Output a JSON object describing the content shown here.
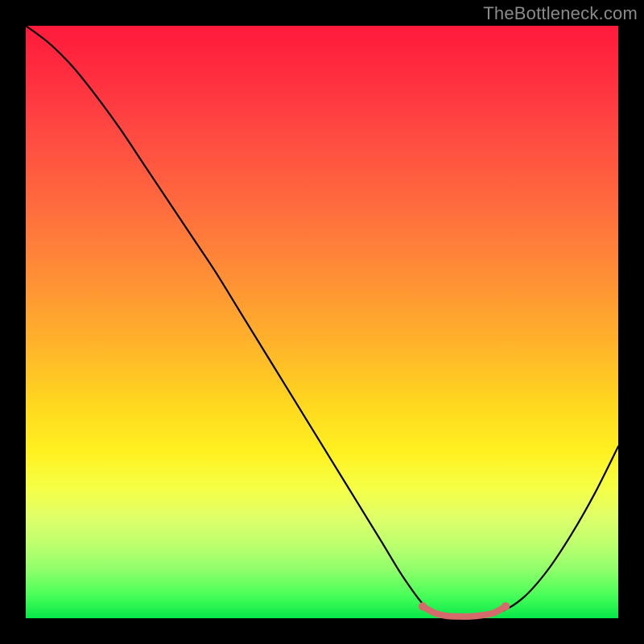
{
  "watermark": "TheBottleneck.com",
  "chart_data": {
    "type": "line",
    "title": "",
    "xlabel": "",
    "ylabel": "",
    "xlim": [
      0,
      100
    ],
    "ylim": [
      0,
      100
    ],
    "grid": false,
    "series": [
      {
        "name": "bottleneck-curve",
        "color": "#000000",
        "x": [
          0,
          4,
          8,
          12,
          16,
          20,
          24,
          28,
          32,
          36,
          40,
          44,
          48,
          52,
          56,
          60,
          64,
          68,
          72,
          76,
          80,
          84,
          88,
          92,
          96,
          100
        ],
        "y": [
          100,
          97,
          93,
          88,
          82.5,
          76.5,
          70.5,
          64.5,
          58.5,
          52.0,
          45.5,
          39.0,
          32.5,
          26.0,
          19.5,
          13.0,
          6.5,
          1.5,
          0.3,
          0.3,
          1.0,
          3.5,
          8.0,
          14.0,
          21.0,
          29.0
        ]
      },
      {
        "name": "optimal-range-marker",
        "color": "#d46a6a",
        "x": [
          67,
          69,
          71,
          73,
          75,
          77,
          79,
          81
        ],
        "y": [
          2.0,
          0.9,
          0.4,
          0.3,
          0.3,
          0.5,
          0.9,
          2.0
        ]
      }
    ],
    "optimal_range": {
      "x_start": 67,
      "x_end": 81
    }
  }
}
